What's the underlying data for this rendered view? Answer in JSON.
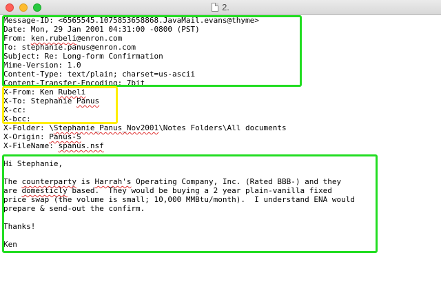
{
  "window": {
    "title": "2."
  },
  "headers": {
    "message_id": "Message-ID: <6565545.1075853658868.JavaMail.evans@thyme>",
    "date": "Date: Mon, 29 Jan 2001 04:31:00 -0800 (PST)",
    "from_pre": "From: ",
    "from_word": "ken.rubeli",
    "from_post": "@enron.com",
    "to": "To: stephanie.panus@enron.com",
    "subject": "Subject: Re: Long-form Confirmation",
    "mime": "Mime-Version: 1.0",
    "content_type": "Content-Type: text/plain; charset=us-ascii",
    "encoding": "Content-Transfer-Encoding: 7bit",
    "xfrom_pre": "X-From: Ken ",
    "xfrom_word": "Rubeli",
    "xto_pre": "X-To: Stephanie ",
    "xto_word": "Panus",
    "xcc": "X-cc: ",
    "xbcc": "X-bcc: ",
    "xfolder_pre": "X-Folder: \\",
    "xfolder_word": "Stephanie_Panus_Nov2001",
    "xfolder_post": "\\Notes Folders\\All documents",
    "xorigin_pre": "X-Origin: ",
    "xorigin_word": "Panus-S",
    "xfilename_pre": "X-FileName: ",
    "xfilename_word": "spanus.nsf"
  },
  "body": {
    "greeting": "Hi Stephanie,",
    "l1_a": "The ",
    "l1_b": "counterparty",
    "l1_c": " is ",
    "l1_d": "Harrah's",
    "l1_e": " Operating Company, Inc. (Rated BBB-) and they",
    "l2_a": "are ",
    "l2_b": "domesticly",
    "l2_c": " based.  They would be buying a 2 year plain-vanilla fixed",
    "l3": "price swap (the volume is small; 10,000 MMBtu/month).  I understand ENA would",
    "l4": "prepare & send-out the confirm.",
    "thanks": "Thanks!",
    "signature": "Ken"
  },
  "colors": {
    "highlight_green": "#22dd22",
    "highlight_yellow": "#ffee00",
    "spellcheck_red": "#e03030"
  }
}
